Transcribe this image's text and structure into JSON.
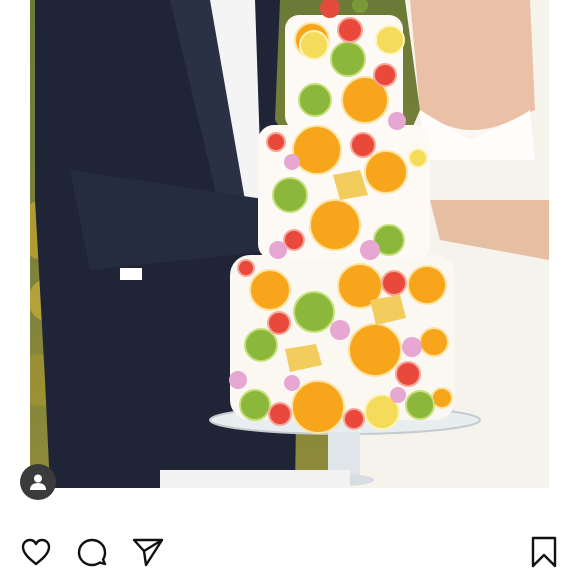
{
  "post": {
    "image_alt": "",
    "avatar_icon": "user-silhouette-icon"
  },
  "actions": {
    "like_icon": "heart-outline-icon",
    "comment_icon": "speech-bubble-icon",
    "share_icon": "paper-plane-icon",
    "save_icon": "bookmark-outline-icon"
  },
  "colors": {
    "icon_stroke": "#111111",
    "avatar_bg": "#3b3b3b"
  }
}
